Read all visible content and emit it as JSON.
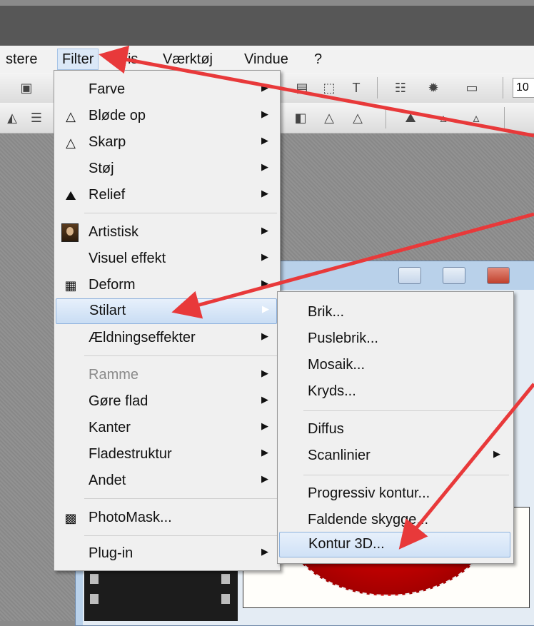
{
  "menubar": {
    "items": [
      "stere",
      "Filter",
      "Vis",
      "Værktøj",
      "Vindue",
      "?"
    ],
    "active": "Filter"
  },
  "toolbar": {
    "zoom_value": "10"
  },
  "filter_menu": {
    "items": [
      {
        "label": "Farve",
        "icon": "none",
        "submenu": true
      },
      {
        "label": "Bløde op",
        "icon": "drop-icon",
        "submenu": true
      },
      {
        "label": "Skarp",
        "icon": "triangle-icon",
        "submenu": true
      },
      {
        "label": "Støj",
        "icon": "none",
        "submenu": true
      },
      {
        "label": "Relief",
        "icon": "relief-icon",
        "submenu": true
      },
      {
        "label": "Artistisk",
        "icon": "mona-lisa-icon",
        "submenu": true
      },
      {
        "label": "Visuel effekt",
        "icon": "none",
        "submenu": true
      },
      {
        "label": "Deform",
        "icon": "grid-icon",
        "submenu": true
      },
      {
        "label": "Stilart",
        "icon": "none",
        "submenu": true,
        "highlighted": true
      },
      {
        "label": "Ældningseffekter",
        "icon": "none",
        "submenu": true
      },
      {
        "label": "Ramme",
        "icon": "none",
        "submenu": true,
        "disabled": true
      },
      {
        "label": "Gøre flad",
        "icon": "none",
        "submenu": true
      },
      {
        "label": "Kanter",
        "icon": "none",
        "submenu": true
      },
      {
        "label": "Fladestruktur",
        "icon": "none",
        "submenu": true
      },
      {
        "label": "Andet",
        "icon": "none",
        "submenu": true
      },
      {
        "label": "PhotoMask...",
        "icon": "photomask-icon",
        "submenu": false
      },
      {
        "label": "Plug-in",
        "icon": "none",
        "submenu": true
      }
    ]
  },
  "stilart_submenu": {
    "items": [
      {
        "label": "Brik..."
      },
      {
        "label": "Puslebrik..."
      },
      {
        "label": "Mosaik..."
      },
      {
        "label": "Kryds..."
      },
      {
        "label": "Diffus"
      },
      {
        "label": "Scanlinier",
        "submenu": true
      },
      {
        "label": "Progressiv kontur..."
      },
      {
        "label": "Faldende skygge..."
      },
      {
        "label": "Kontur 3D...",
        "highlighted": true
      }
    ]
  },
  "colors": {
    "arrow": "#e8393a",
    "highlight": "#c9ddf4",
    "titlebar": "#575757"
  }
}
